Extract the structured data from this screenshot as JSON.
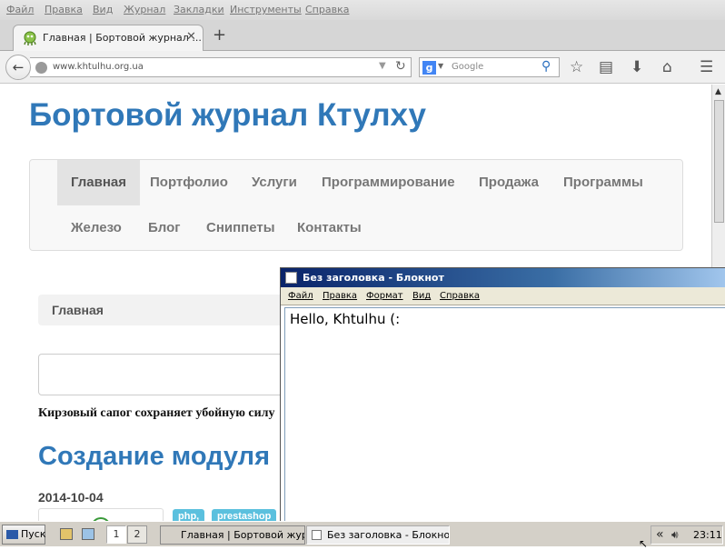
{
  "menubar": {
    "items": [
      "Файл",
      "Правка",
      "Вид",
      "Журнал",
      "Закладки",
      "Инструменты",
      "Справка"
    ]
  },
  "browser": {
    "tab_title": "Главная | Бортовой журнал ...",
    "url": "www.khtulhu.org.ua",
    "search_placeholder": "Google",
    "new_tab_glyph": "+",
    "close_glyph": "✕"
  },
  "page": {
    "site_title": "Бортовой журнал Ктулху",
    "nav": [
      {
        "label": "Главная",
        "active": true
      },
      {
        "label": "Портфолио",
        "active": false
      },
      {
        "label": "Услуги",
        "active": false
      },
      {
        "label": "Программирование",
        "active": false
      },
      {
        "label": "Продажа",
        "active": false
      },
      {
        "label": "Программы",
        "active": false
      },
      {
        "label": "Железо",
        "active": false
      },
      {
        "label": "Блог",
        "active": false
      },
      {
        "label": "Сниппеты",
        "active": false
      },
      {
        "label": "Контакты",
        "active": false
      }
    ],
    "breadcrumb": "Главная",
    "quote": "Кирзовый сапог сохраняет убойную силу",
    "article_title": "Создание модуля",
    "article_date": "2014-10-04",
    "tags": [
      "php,",
      "prestashop"
    ]
  },
  "notepad": {
    "title": "Без заголовка - Блокнот",
    "menu": [
      "Файл",
      "Правка",
      "Формат",
      "Вид",
      "Справка"
    ],
    "content": "Hello, Khtulhu (:"
  },
  "taskbar": {
    "start_label": "Пуск",
    "desktops": [
      "1",
      "2"
    ],
    "tasks": [
      {
        "label": "Главная | Бортовой жур...",
        "active": false
      },
      {
        "label": "Без заголовка - Блокнот",
        "active": true
      }
    ],
    "tray_arrow": "«",
    "clock": "23:11"
  },
  "colors": {
    "link_blue": "#3078b8",
    "tag_blue": "#5bc0de",
    "notepad_title": "#0a246a"
  }
}
